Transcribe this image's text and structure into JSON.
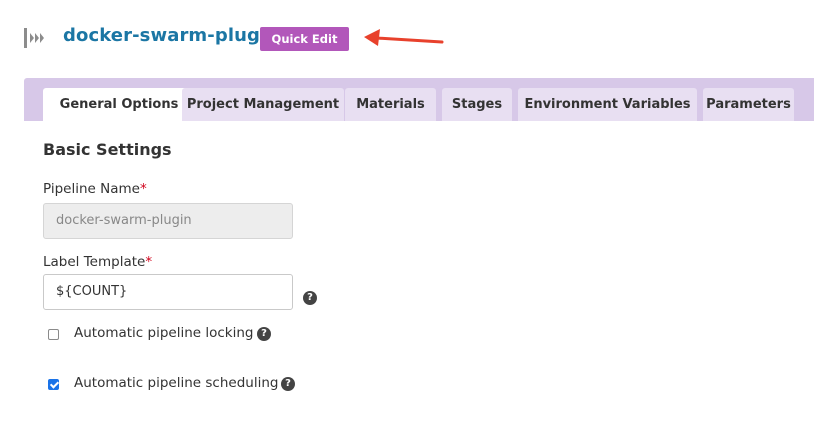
{
  "header": {
    "pipeline_name": "docker-swarm-plugin",
    "quick_edit_label": "Quick Edit",
    "icon": "pipeline-icon"
  },
  "tabs": [
    {
      "label": "General Options",
      "active": true
    },
    {
      "label": "Project Management",
      "active": false
    },
    {
      "label": "Materials",
      "active": false
    },
    {
      "label": "Stages",
      "active": false
    },
    {
      "label": "Environment Variables",
      "active": false
    },
    {
      "label": "Parameters",
      "active": false
    }
  ],
  "basic_settings": {
    "title": "Basic Settings",
    "pipeline_name_label": "Pipeline Name",
    "pipeline_name_value": "docker-swarm-plugin",
    "label_template_label": "Label Template",
    "label_template_value": "${COUNT}",
    "required_marker": "*",
    "help_glyph": "?",
    "auto_locking_label": "Automatic pipeline locking",
    "auto_locking_checked": false,
    "auto_scheduling_label": "Automatic pipeline scheduling",
    "auto_scheduling_checked": true
  },
  "colors": {
    "title_blue": "#1b76a4",
    "quick_edit_purple": "#b257ba",
    "tab_bar": "#d7c8e8",
    "arrow_red": "#e8412c",
    "checkbox_blue": "#1a73e8"
  }
}
